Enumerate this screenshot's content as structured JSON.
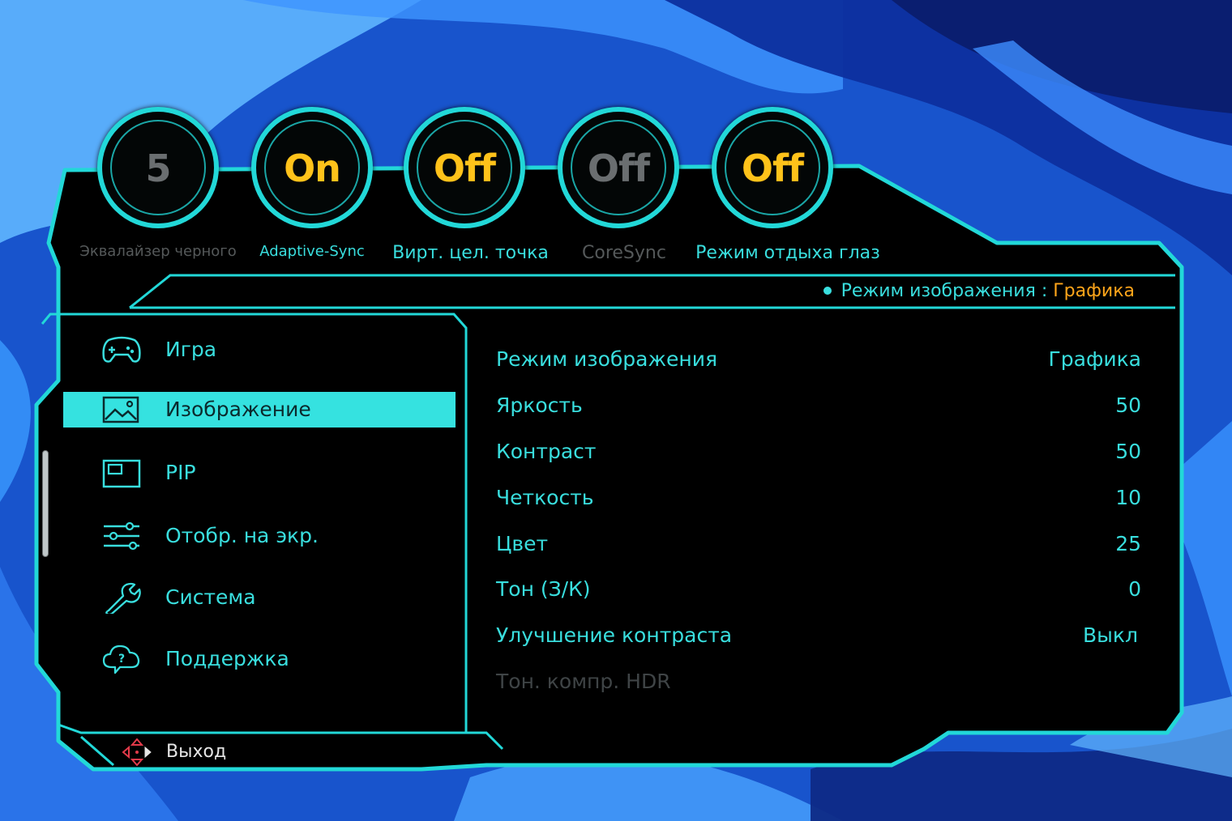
{
  "quick_settings": [
    {
      "value": "5",
      "label": "Эквалайзер черного",
      "active": false
    },
    {
      "value": "On",
      "label": "Adaptive-Sync",
      "active": true
    },
    {
      "value": "Off",
      "label": "Вирт. цел. точка",
      "active": true
    },
    {
      "value": "Off",
      "label": "CoreSync",
      "active": false
    },
    {
      "value": "Off",
      "label": "Режим отдыха глаз",
      "active": true
    }
  ],
  "picture_mode_indicator": {
    "label": "Режим изображения :",
    "value": "Графика"
  },
  "menu": {
    "items": [
      {
        "label": "Игра",
        "icon": "gamepad-icon",
        "selected": false
      },
      {
        "label": "Изображение",
        "icon": "picture-icon",
        "selected": true
      },
      {
        "label": "PIP",
        "icon": "pip-icon",
        "selected": false
      },
      {
        "label": "Отобр. на экр.",
        "icon": "sliders-icon",
        "selected": false
      },
      {
        "label": "Система",
        "icon": "wrench-icon",
        "selected": false
      },
      {
        "label": "Поддержка",
        "icon": "support-cloud-icon",
        "selected": false
      }
    ]
  },
  "settings": [
    {
      "label": "Режим изображения",
      "value": "Графика",
      "enabled": true
    },
    {
      "label": "Яркость",
      "value": "50",
      "enabled": true
    },
    {
      "label": "Контраст",
      "value": "50",
      "enabled": true
    },
    {
      "label": "Четкость",
      "value": "10",
      "enabled": true
    },
    {
      "label": "Цвет",
      "value": "25",
      "enabled": true
    },
    {
      "label": "Тон (З/К)",
      "value": "0",
      "enabled": true
    },
    {
      "label": "Улучшение контраста",
      "value": "Выкл",
      "enabled": true
    },
    {
      "label": "Тон. компр. HDR",
      "value": "",
      "enabled": false
    }
  ],
  "exit_hint": {
    "label": "Выход",
    "icon": "navigation-arrows-icon"
  },
  "colors": {
    "accent": "#35e2e0",
    "text": "#39dede",
    "value_active": "#ffc21a",
    "mode_value": "#ffa51a",
    "disabled": "#55595a",
    "panel": "#030606"
  }
}
